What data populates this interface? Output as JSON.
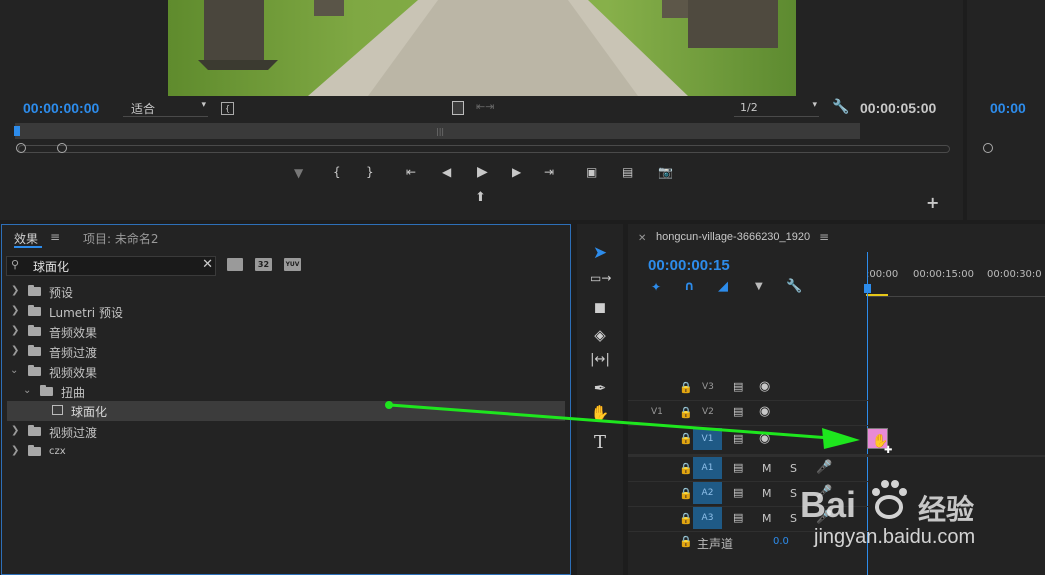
{
  "monitor": {
    "timecode_left": "00:00:00:00",
    "fit_select": "适合",
    "resolution_select": "1/2",
    "timecode_right": "00:00:05:00",
    "timecode_right_panel": "00:00"
  },
  "effects_panel": {
    "tab_effects": "效果",
    "tab_project": "项目: 未命名2",
    "search_value": "球面化",
    "badge_32": "32",
    "badge_yuv": "YUV",
    "items": [
      {
        "label": "预设"
      },
      {
        "label": "Lumetri 预设"
      },
      {
        "label": "音频效果"
      },
      {
        "label": "音频过渡"
      },
      {
        "label": "视频效果"
      },
      {
        "label": "扭曲"
      },
      {
        "label": "球面化"
      },
      {
        "label": "视频过渡"
      },
      {
        "label": "czx"
      }
    ]
  },
  "timeline": {
    "sequence_name": "hongcun-village-3666230_1920",
    "timecode": "00:00:00:15",
    "ruler_labels": [
      ":00:00",
      "00:00:15:00",
      "00:00:30:0"
    ],
    "tracks": {
      "v3": "V3",
      "v2": "V2",
      "v1": "V1",
      "v1_source": "V1",
      "a1": "A1",
      "a2": "A2",
      "a3": "A3",
      "mute": "M",
      "solo": "S",
      "master": "主声道",
      "master_value": "0.0"
    }
  },
  "watermark": {
    "brand": "Bai",
    "brand2": "经验",
    "url": "jingyan.baidu.com"
  },
  "colors": {
    "accent_blue": "#2d8ceb",
    "drag_arrow": "#1ee61e",
    "track_tag": "#1f5a86",
    "clip_pink": "#e88ad6"
  }
}
